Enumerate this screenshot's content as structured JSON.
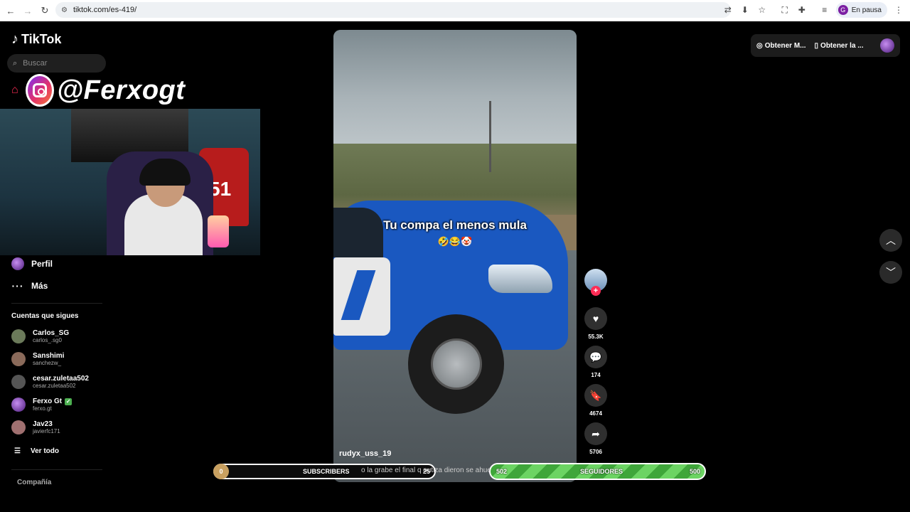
{
  "browser": {
    "url": "tiktok.com/es-419/",
    "profile_initial": "G",
    "profile_status": "En pausa"
  },
  "sidebar": {
    "logo": "TikTok",
    "search_placeholder": "Buscar",
    "profile_label": "Perfil",
    "more_label": "Más",
    "following_title": "Cuentas que sigues",
    "following": [
      {
        "name": "Carlos_SG",
        "user": "carlos_.sg0",
        "verified": false
      },
      {
        "name": "Sanshimi",
        "user": "sanchezw_",
        "verified": false
      },
      {
        "name": "cesar.zuletaa502",
        "user": "cesar.zuletaa502",
        "verified": false
      },
      {
        "name": "Ferxo Gt",
        "user": "ferxo.gt",
        "verified": true
      },
      {
        "name": "Jav23",
        "user": "javierfc171",
        "verified": false
      }
    ],
    "see_all": "Ver todo",
    "company": "Compañía"
  },
  "overlay": {
    "handle": "@Ferxogt",
    "jersey_number": "51"
  },
  "video": {
    "caption": "Tu compa el menos mula",
    "caption_emoji": "🤣😂🤡",
    "author": "rudyx_uss_19",
    "description": "o la grabe el final q putiza dieron se ahuevo"
  },
  "actions": {
    "likes": "55.3K",
    "comments": "174",
    "saves": "4674",
    "shares": "5706"
  },
  "top_right": {
    "item1": "Obtener M...",
    "item2": "Obtener la ..."
  },
  "stream_bars": {
    "subs_current": "0",
    "subs_label": "SUBSCRIBERS",
    "subs_goal": "25",
    "subs_progress": 0,
    "followers_current": "502",
    "followers_label": "SEGUIDORES",
    "followers_goal": "500",
    "followers_progress": 1.0
  }
}
